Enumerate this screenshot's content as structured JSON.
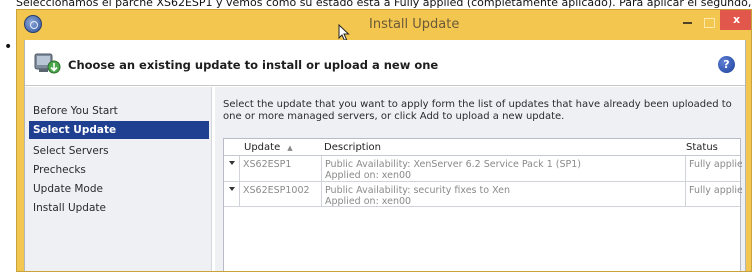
{
  "top_text": "Seleccionamos el parche XS62ESP1 y vemos como su estado está a Fully applied (completamente aplicado). Para aplicar el segundo,",
  "window": {
    "title": "Install Update",
    "close_label": "x"
  },
  "header": {
    "title": "Choose an existing update to install or upload a new one",
    "help_label": "?"
  },
  "nav": {
    "items": [
      {
        "label": "Before You Start",
        "active": false
      },
      {
        "label": "Select Update",
        "active": true
      },
      {
        "label": "Select Servers",
        "active": false
      },
      {
        "label": "Prechecks",
        "active": false
      },
      {
        "label": "Update Mode",
        "active": false
      },
      {
        "label": "Install Update",
        "active": false
      }
    ]
  },
  "main": {
    "instruction": "Select the update that you want to apply form the list of updates that have already been uploaded to one or more managed servers, or click Add to upload a new update.",
    "columns": {
      "update": "Update",
      "description": "Description",
      "status": "Status"
    },
    "sort_indicator": "▲",
    "rows": [
      {
        "update": "XS62ESP1",
        "description_line1": "Public Availability: XenServer 6.2 Service Pack 1 (SP1)",
        "description_line2": "Applied on: xen00",
        "status": "Fully applied"
      },
      {
        "update": "XS62ESP1002",
        "description_line1": "Public Availability: security fixes to Xen",
        "description_line2": "Applied on: xen00",
        "status": "Fully applied"
      }
    ]
  },
  "colors": {
    "titlebar": "#f3c64f",
    "nav_active": "#1f3f91",
    "close_button": "#e2574c"
  }
}
